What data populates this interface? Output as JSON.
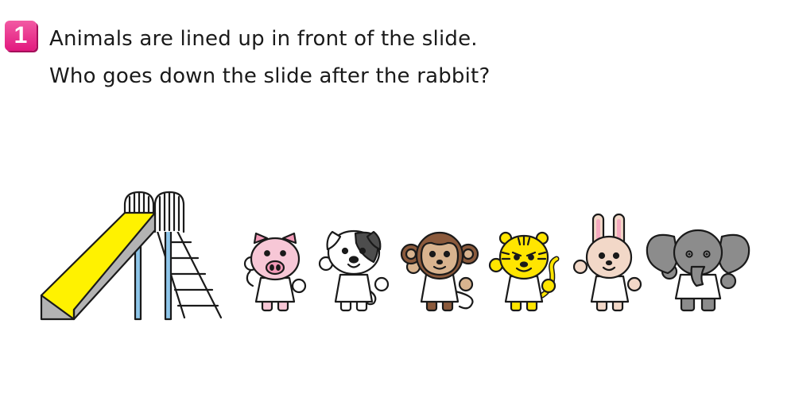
{
  "problem": {
    "number": "1",
    "line1": "Animals are lined up in front of the slide.",
    "line2": "Who goes down the slide after the rabbit?"
  },
  "scene": {
    "order_from_slide": [
      "pig",
      "dog",
      "monkey",
      "tiger",
      "rabbit",
      "elephant"
    ],
    "colors": {
      "badge": "#e2197f",
      "slide_yellow": "#fff200",
      "slide_gray": "#b3b3b3",
      "slide_pole_blue": "#8ec6ea",
      "pig": "#f7c7d6",
      "monkey_brown": "#8b5a3c",
      "monkey_face": "#d9b48f",
      "tiger_yellow": "#ffe500",
      "rabbit": "#f2d8c8",
      "elephant": "#8c8c8c"
    }
  }
}
